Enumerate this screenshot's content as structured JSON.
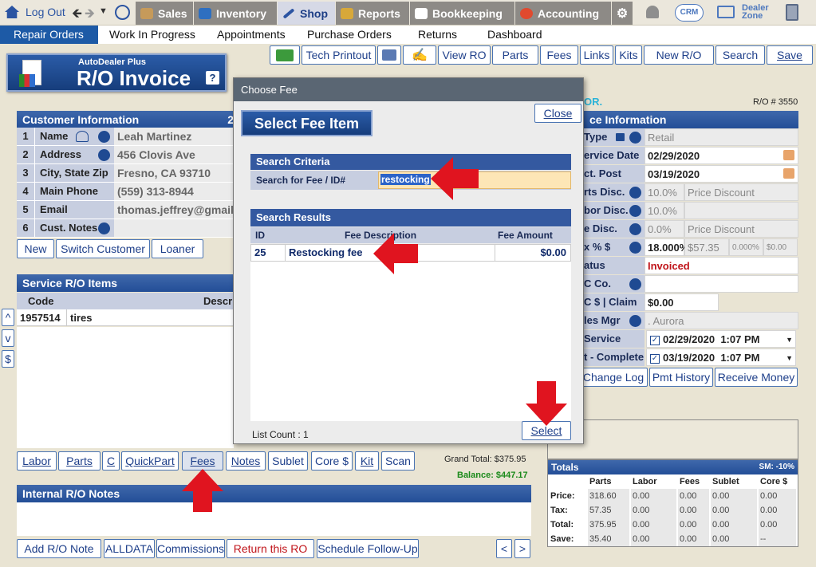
{
  "topnav": {
    "logout": "Log Out",
    "items": [
      "Sales",
      "Inventory",
      "Shop",
      "Reports",
      "Bookkeeping",
      "Accounting"
    ],
    "crm": "CRM",
    "dealer_zone_1": "Dealer",
    "dealer_zone_2": "Zone"
  },
  "subnav": [
    "Repair Orders",
    "Work In Progress",
    "Appointments",
    "Purchase Orders",
    "Returns",
    "Dashboard"
  ],
  "toolbar": [
    "Tech Printout",
    "View RO",
    "Parts",
    "Fees",
    "Links",
    "Kits",
    "New R/O",
    "Search",
    "Save"
  ],
  "title": {
    "small": "AutoDealer Plus",
    "big": "R/O Invoice",
    "help": "?"
  },
  "customer": {
    "header": "Customer Information",
    "header_num": "2",
    "rows": [
      {
        "n": "1",
        "label": "Name",
        "value": "Leah Martinez"
      },
      {
        "n": "2",
        "label": "Address",
        "value": "456 Clovis Ave"
      },
      {
        "n": "3",
        "label": "City, State Zip",
        "value": "Fresno, CA 93710"
      },
      {
        "n": "4",
        "label": "Main Phone",
        "value": "(559) 313-8944"
      },
      {
        "n": "5",
        "label": "Email",
        "value": "thomas.jeffrey@gmail.c"
      },
      {
        "n": "6",
        "label": "Cust. Notes",
        "value": ""
      }
    ],
    "buttons": [
      "New",
      "Switch Customer",
      "Loaner"
    ]
  },
  "items": {
    "header": "Service R/O Items",
    "col_code": "Code",
    "col_desc": "Descri",
    "row": {
      "code": "1957514",
      "desc": "tires"
    },
    "side_buttons": [
      "^",
      "v",
      "$"
    ]
  },
  "bottom_buttons": [
    "Labor",
    "Parts",
    "C",
    "QuickPart",
    "Fees",
    "Notes",
    "Sublet",
    "Core $",
    "Kit",
    "Scan"
  ],
  "grand_total": "Grand Total: $375.95",
  "balance": "Balance: $447.17",
  "notes_header": "Internal R/O Notes",
  "footer_buttons": [
    "Add R/O Note",
    "ALLDATA",
    "Commissions",
    "Return this RO",
    "Schedule Follow-Up",
    "<",
    ">"
  ],
  "info": {
    "dor": "OR.",
    "ro_num": "R/O # 3550",
    "header": "ce Information",
    "rows": [
      {
        "label": "Type",
        "value": "Retail"
      },
      {
        "label": "ervice Date",
        "value": "02/29/2020"
      },
      {
        "label": "ct. Post Date",
        "value": "03/19/2020"
      },
      {
        "label": "rts Disc.",
        "value": "10.0%",
        "extra": "Price Discount"
      },
      {
        "label": "bor Disc.",
        "value": "10.0%",
        "extra": ""
      },
      {
        "label": "e Disc.",
        "value": "0.0%",
        "extra": "Price Discount"
      },
      {
        "label": "x % $",
        "value": "18.000%",
        "extra": "$57.35",
        "extra2": "0.000%",
        "extra3": "$0.00"
      },
      {
        "label": "atus",
        "value": "Invoiced"
      },
      {
        "label": "C  Co.",
        "value": ""
      },
      {
        "label": "C $ | Claim #",
        "value": "$0.00"
      },
      {
        "label": "les Mgr",
        "value": ". Aurora"
      },
      {
        "label": "Service",
        "date": "02/29/2020",
        "time": "1:07 PM"
      },
      {
        "label": "t - Complete",
        "date": "03/19/2020",
        "time": "1:07 PM"
      }
    ],
    "buttons": [
      "Change Log",
      "Pmt History",
      "Receive Money"
    ]
  },
  "totals": {
    "header": "Totals",
    "sm": "SM: -10%",
    "cols": [
      "Parts",
      "Labor",
      "Fees",
      "Sublet",
      "Core $"
    ],
    "rows": [
      {
        "label": "Price:",
        "vals": [
          "318.60",
          "0.00",
          "0.00",
          "0.00",
          "0.00"
        ]
      },
      {
        "label": "Tax:",
        "vals": [
          "57.35",
          "0.00",
          "0.00",
          "0.00",
          "0.00"
        ]
      },
      {
        "label": "Total:",
        "vals": [
          "375.95",
          "0.00",
          "0.00",
          "0.00",
          "0.00"
        ]
      },
      {
        "label": "Save:",
        "vals": [
          "35.40",
          "0.00",
          "0.00",
          "0.00",
          "--"
        ]
      }
    ]
  },
  "modal": {
    "title": "Choose Fee",
    "close": "Close",
    "heading": "Select Fee Item",
    "criteria_header": "Search Criteria",
    "search_label": "Search for Fee / ID#",
    "search_value": "restocking",
    "results_header": "Search Results",
    "cols": [
      "ID",
      "Fee Description",
      "Fee Amount"
    ],
    "result": {
      "id": "25",
      "desc": "Restocking fee",
      "amount": "$0.00"
    },
    "list_count": "List Count : 1",
    "select": "Select"
  },
  "colors": {
    "accent": "#1d5aa6",
    "arrow": "#e0141f",
    "invoiced": "#c0141a",
    "balance": "#1a8a1a"
  }
}
